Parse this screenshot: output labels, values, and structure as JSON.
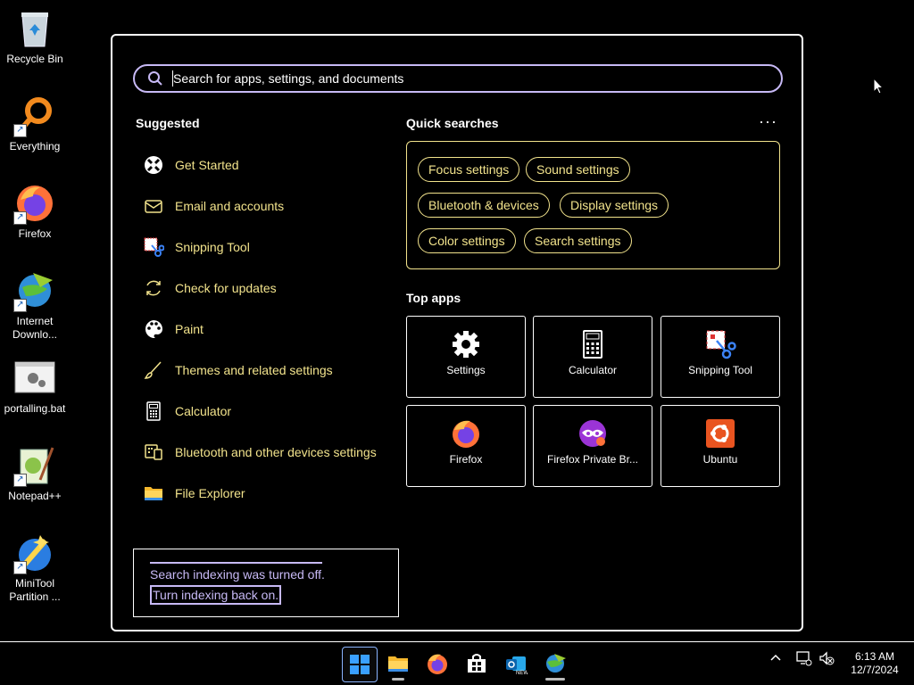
{
  "desktop": {
    "icons": [
      {
        "label": "Recycle Bin",
        "icon": "recycle-bin-icon"
      },
      {
        "label": "Everything",
        "icon": "everything-search-icon"
      },
      {
        "label": "Firefox",
        "icon": "firefox-icon"
      },
      {
        "label": "Internet Downlo...",
        "icon": "internet-download-manager-icon"
      },
      {
        "label": "portalling.bat",
        "icon": "batch-file-icon"
      },
      {
        "label": "Notepad++",
        "icon": "notepad-plus-plus-icon"
      },
      {
        "label": "MiniTool Partition ...",
        "icon": "minitool-partition-icon"
      }
    ]
  },
  "search_panel": {
    "search": {
      "placeholder": "Search for apps, settings, and documents",
      "value": ""
    },
    "suggested": {
      "heading": "Suggested",
      "items": [
        {
          "label": "Get Started",
          "icon": "get-started-icon"
        },
        {
          "label": "Email and accounts",
          "icon": "email-icon"
        },
        {
          "label": "Snipping Tool",
          "icon": "snipping-tool-icon"
        },
        {
          "label": "Check for updates",
          "icon": "refresh-icon"
        },
        {
          "label": "Paint",
          "icon": "paint-palette-icon"
        },
        {
          "label": "Themes and related settings",
          "icon": "brush-icon"
        },
        {
          "label": "Calculator",
          "icon": "calculator-icon"
        },
        {
          "label": "Bluetooth and other devices settings",
          "icon": "devices-icon"
        },
        {
          "label": "File Explorer",
          "icon": "folder-icon"
        }
      ]
    },
    "quick_searches": {
      "heading": "Quick searches",
      "more": "···",
      "chips": [
        "Focus settings",
        "Sound settings",
        "Bluetooth & devices",
        "Display settings",
        "Color settings",
        "Search settings"
      ]
    },
    "top_apps": {
      "heading": "Top apps",
      "apps": [
        {
          "label": "Settings",
          "icon": "gear-icon"
        },
        {
          "label": "Calculator",
          "icon": "calculator-icon"
        },
        {
          "label": "Snipping Tool",
          "icon": "snipping-tool-icon"
        },
        {
          "label": "Firefox",
          "icon": "firefox-icon"
        },
        {
          "label": "Firefox Private Br...",
          "icon": "firefox-private-icon"
        },
        {
          "label": "Ubuntu",
          "icon": "ubuntu-icon"
        }
      ]
    },
    "indexing_notice": {
      "message": "Search indexing was turned off.",
      "link": "Turn indexing back on."
    }
  },
  "taskbar": {
    "apps": [
      "start-icon",
      "file-explorer-icon",
      "firefox-icon",
      "microsoft-store-icon",
      "outlook-icon",
      "internet-download-manager-icon"
    ],
    "tray_icons": [
      "chevron-up-icon",
      "network-icon",
      "volume-muted-icon"
    ],
    "clock": {
      "time": "6:13 AM",
      "date": "12/7/2024"
    }
  },
  "colors": {
    "accent_yellow": "#f2e38c",
    "accent_lavender": "#c7b9f5",
    "background": "#000000"
  }
}
